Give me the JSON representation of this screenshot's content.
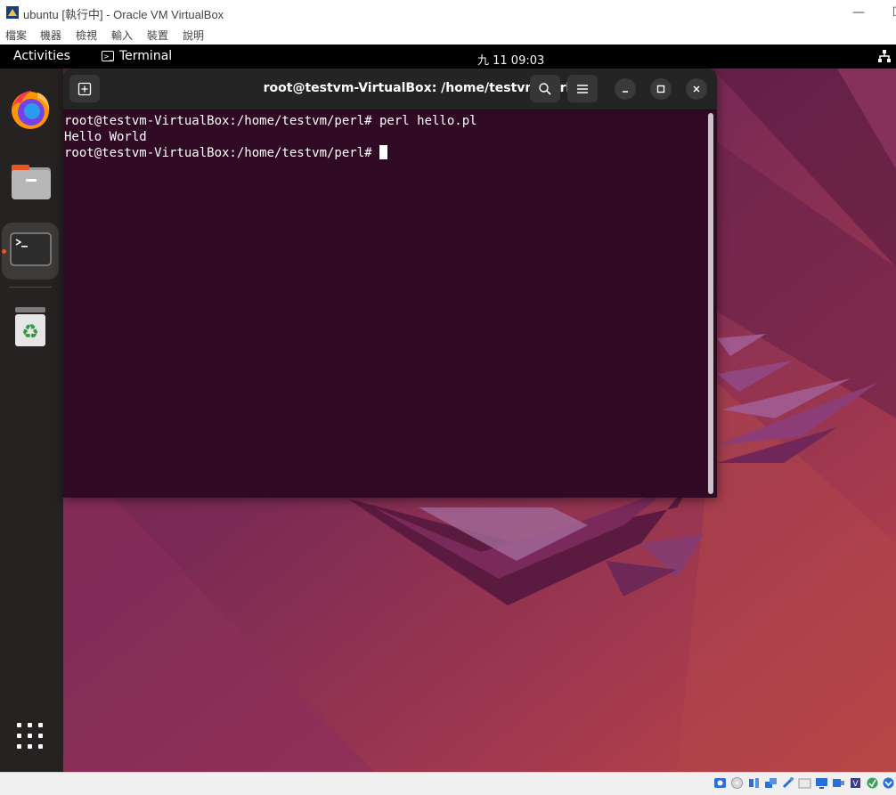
{
  "host": {
    "title": "ubuntu [執行中] - Oracle VM VirtualBox",
    "minimize_glyph": "—",
    "maximize_glyph": "☐",
    "menu": [
      "檔案",
      "機器",
      "檢視",
      "輸入",
      "裝置",
      "說明"
    ]
  },
  "gnome": {
    "activities": "Activities",
    "app_name": "Terminal",
    "app_icon_glyph": ">_",
    "clock": "九 11  09:03"
  },
  "dock": {
    "items": [
      {
        "icon": "firefox-icon"
      },
      {
        "icon": "files-icon"
      },
      {
        "icon": "terminal-icon",
        "running": true
      },
      {
        "icon": "trash-icon"
      }
    ],
    "show_apps_icon": "grid-icon"
  },
  "terminal": {
    "title": "root@testvm-VirtualBox: /home/testvm/perl",
    "lines": [
      "root@testvm-VirtualBox:/home/testvm/perl# perl hello.pl",
      "Hello World",
      "root@testvm-VirtualBox:/home/testvm/perl# "
    ]
  },
  "colors": {
    "terminal_bg": "#300a24",
    "dock_bg": "#272222",
    "accent": "#e95420"
  }
}
